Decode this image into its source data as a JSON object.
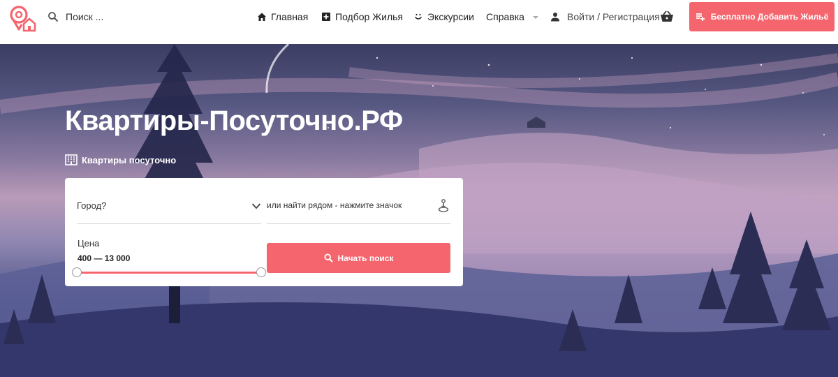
{
  "header": {
    "search_placeholder": "Поиск ...",
    "nav": {
      "home": "Главная",
      "pick": "Подбор Жилья",
      "tours": "Экскурсии",
      "help": "Справка",
      "login": "Войти / Регистрация"
    },
    "add_button": "Бесплатно Добавить Жильё"
  },
  "hero": {
    "title": "Квартиры-Посуточно.РФ",
    "subtitle": "Квартиры посуточно"
  },
  "search_card": {
    "city_placeholder": "Город?",
    "near_placeholder": "или найти рядом - нажмите значок",
    "price_label": "Цена",
    "price_range": "400 — 13 000",
    "price_min": 400,
    "price_max": 13000,
    "search_button": "Начать поиск"
  },
  "colors": {
    "accent": "#f5656e"
  },
  "icons": [
    "logo-icon",
    "search-icon",
    "home-icon",
    "plus-box-icon",
    "smile-icon",
    "person-icon",
    "basket-icon",
    "playlist-add-icon",
    "building-icon",
    "chevron-down-icon",
    "location-person-icon"
  ]
}
